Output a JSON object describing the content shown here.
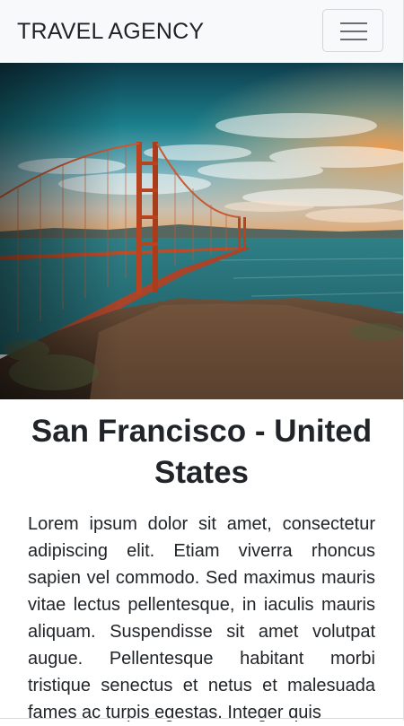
{
  "navbar": {
    "brand": "TRAVEL AGENCY",
    "toggler_icon": "hamburger-menu-icon"
  },
  "hero": {
    "image": "golden-gate-bridge-photo"
  },
  "article": {
    "title": "San Francisco - United States",
    "body": "Lorem ipsum dolor sit amet, consectetur adipiscing elit. Etiam viverra rhoncus sapien vel commodo. Sed maximus mauris vitae lectus pellentesque, in iaculis mauris aliquam. Suspendisse sit amet volutpat augue. Pellentesque habitant morbi tristique senectus et netus et malesuada fames ac turpis egestas. Integer quis"
  },
  "colors": {
    "navbar_bg": "#f8f9fa",
    "text": "#212529"
  }
}
